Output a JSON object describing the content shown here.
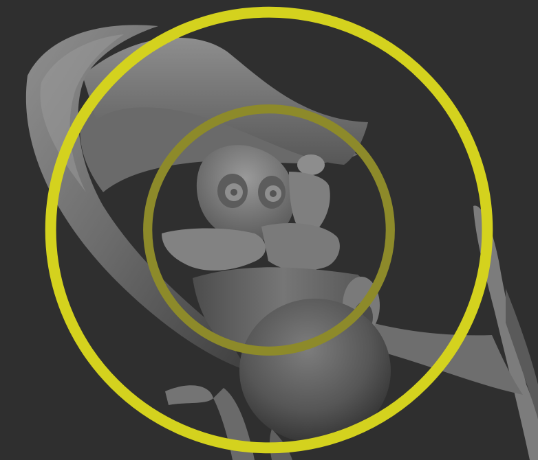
{
  "viewport": {
    "background": "#2f2f2f"
  },
  "model": {
    "shading": "matcap-gray",
    "base_color": "#6f6f6f",
    "highlight_color": "#a3a3a3",
    "shadow_color": "#4a4a4a"
  },
  "brush_cursor": {
    "icon": "brush-cursor-icon",
    "color": "#d4d21e"
  }
}
